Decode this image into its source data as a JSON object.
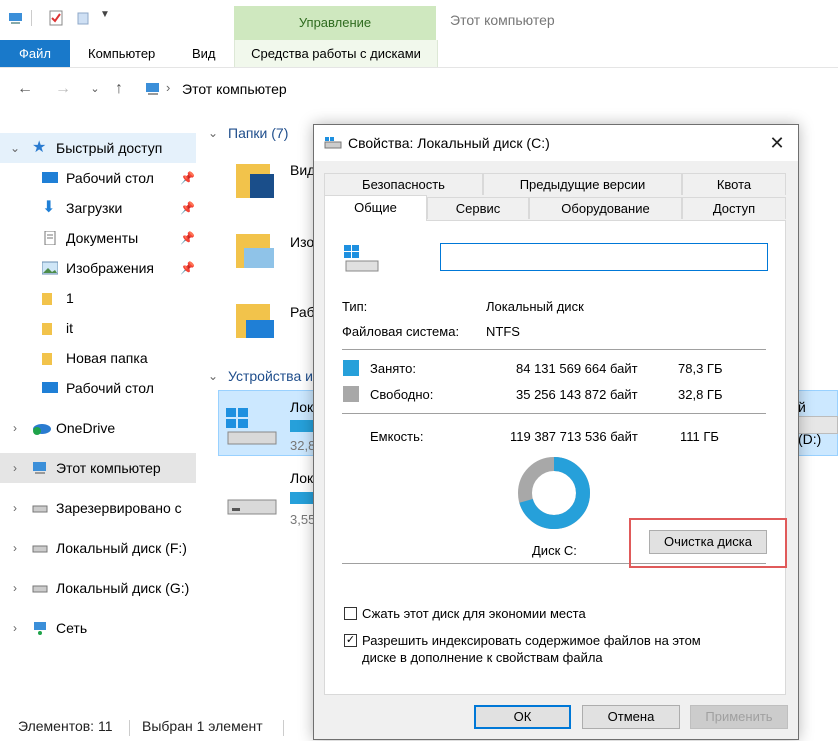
{
  "ribbon": {
    "manage": "Управление",
    "window_title": "Этот компьютер",
    "tabs": [
      "Файл",
      "Компьютер",
      "Вид"
    ],
    "disk_tools": "Средства работы с дисками"
  },
  "address": {
    "crumb": "Этот компьютер"
  },
  "sidebar": {
    "quick_access": "Быстрый доступ",
    "items": [
      "Рабочий стол",
      "Загрузки",
      "Документы",
      "Изображения",
      "1",
      "it",
      "Новая папка",
      "Рабочий стол"
    ],
    "onedrive": "OneDrive",
    "this_pc": "Этот компьютер",
    "reserved": "Зарезервировано с",
    "disk_f": "Локальный диск (F:)",
    "disk_g": "Локальный диск (G:)",
    "network": "Сеть"
  },
  "content": {
    "folders_header": "Папки (7)",
    "folder_labels": [
      "Вид",
      "Изо",
      "Раб"
    ],
    "devices_header": "Устройства и",
    "drive1_name": "Лока",
    "drive1_free": "32,8",
    "drive2_name": "Лок",
    "drive2_free": "3,55",
    "drive_right": "й диск (D:)"
  },
  "dialog": {
    "title": "Свойства: Локальный диск (C:)",
    "tabs_row1": [
      "Безопасность",
      "Предыдущие версии",
      "Квота"
    ],
    "tabs_row2": [
      "Общие",
      "Сервис",
      "Оборудование",
      "Доступ"
    ],
    "name_value": "",
    "type_label": "Тип:",
    "type_value": "Локальный диск",
    "fs_label": "Файловая система:",
    "fs_value": "NTFS",
    "used_label": "Занято:",
    "used_bytes": "84 131 569 664 байт",
    "used_gb": "78,3 ГБ",
    "free_label": "Свободно:",
    "free_bytes": "35 256 143 872 байт",
    "free_gb": "32,8 ГБ",
    "cap_label": "Емкость:",
    "cap_bytes": "119 387 713 536 байт",
    "cap_gb": "111 ГБ",
    "disk_label": "Диск C:",
    "cleanup_button": "Очистка диска",
    "compress_label": "Сжать этот диск для экономии места",
    "compress_checked": false,
    "index_label_1": "Разрешить индексировать содержимое файлов на этом",
    "index_label_2": "диске в дополнение к свойствам файла",
    "index_checked": true,
    "ok": "ОК",
    "cancel": "Отмена",
    "apply": "Применить",
    "used_fraction": 0.705,
    "used_color": "#26a0da",
    "free_color": "#a8a8a8"
  },
  "status": {
    "items": "Элементов: 11",
    "selected": "Выбран 1 элемент"
  }
}
